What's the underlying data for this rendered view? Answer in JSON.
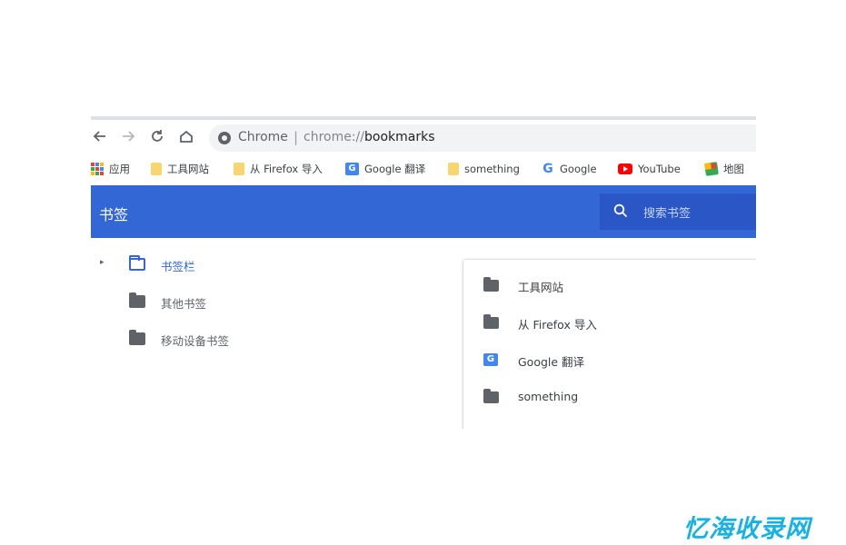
{
  "toolbar": {
    "back_icon": "arrow-left-icon",
    "forward_icon": "arrow-right-icon",
    "reload_icon": "reload-icon",
    "home_icon": "home-icon",
    "omnibox": {
      "site_label": "Chrome",
      "separator": "|",
      "url_scheme": "chrome://",
      "url_path": "bookmarks"
    }
  },
  "bookmarks_bar": [
    {
      "label": "应用",
      "icon": "apps-grid-icon"
    },
    {
      "label": "工具网站",
      "icon": "folder-icon"
    },
    {
      "label": "从 Firefox 导入",
      "icon": "folder-icon"
    },
    {
      "label": "Google 翻译",
      "icon": "google-translate-icon"
    },
    {
      "label": "something",
      "icon": "folder-icon"
    },
    {
      "label": "Google",
      "icon": "google-icon"
    },
    {
      "label": "YouTube",
      "icon": "youtube-icon"
    },
    {
      "label": "地图",
      "icon": "maps-icon"
    }
  ],
  "header": {
    "title": "书签",
    "search_placeholder": "搜索书签",
    "background_color": "#3367d6"
  },
  "sidebar": {
    "items": [
      {
        "label": "书签栏",
        "expanded_arrow": "▸",
        "selected": true
      },
      {
        "label": "其他书签",
        "selected": false
      },
      {
        "label": "移动设备书签",
        "selected": false
      }
    ]
  },
  "list": {
    "items": [
      {
        "label": "工具网站",
        "icon": "folder-icon"
      },
      {
        "label": "从 Firefox 导入",
        "icon": "folder-icon"
      },
      {
        "label": "Google 翻译",
        "icon": "google-translate-icon"
      },
      {
        "label": "something",
        "icon": "folder-icon"
      }
    ]
  },
  "watermark": "忆海收录网",
  "colors": {
    "accent": "#3367d6",
    "search_box": "#2a56c6",
    "folder_gray": "#5f6368",
    "bookmark_folder_yellow": "#f9d56e",
    "watermark": "#17b1e6"
  }
}
